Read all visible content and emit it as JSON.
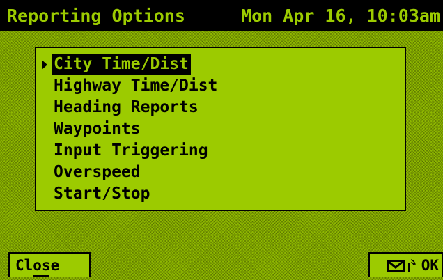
{
  "header": {
    "title": "Reporting Options",
    "datetime": "Mon Apr 16, 10:03am"
  },
  "menu": {
    "items": [
      {
        "label": "City Time/Dist",
        "selected": true
      },
      {
        "label": "Highway Time/Dist",
        "selected": false
      },
      {
        "label": "Heading Reports",
        "selected": false
      },
      {
        "label": "Waypoints",
        "selected": false
      },
      {
        "label": "Input Triggering",
        "selected": false
      },
      {
        "label": "Overspeed",
        "selected": false
      },
      {
        "label": "Start/Stop",
        "selected": false
      }
    ]
  },
  "softkeys": {
    "left_label": "Close",
    "right_label": "OK",
    "right_icons": [
      "envelope-icon",
      "antenna-icon"
    ]
  },
  "colors": {
    "screen": "#9ccb00",
    "ink": "#000000"
  }
}
